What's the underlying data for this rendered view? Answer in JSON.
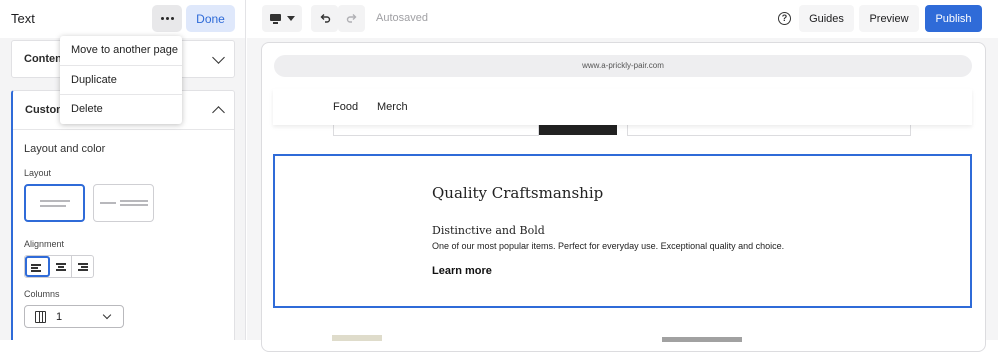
{
  "panel": {
    "title": "Text",
    "done_label": "Done",
    "content_label": "Content",
    "customize_label": "Customize",
    "layout_color_heading": "Layout and color",
    "layout_label": "Layout",
    "alignment_label": "Alignment",
    "columns_label": "Columns",
    "columns_value": "1",
    "selected_layout": "left-aligned",
    "selected_alignment": "left"
  },
  "menu": {
    "items": [
      "Move to another page",
      "Duplicate",
      "Delete"
    ]
  },
  "toolbar": {
    "device": "desktop",
    "autosaved": "Autosaved",
    "guides": "Guides",
    "preview": "Preview",
    "publish": "Publish"
  },
  "site": {
    "url": "www.a-prickly-pair.com",
    "nav": [
      "Food",
      "Merch"
    ],
    "section_title": "Quality Craftsmanship",
    "section_subtitle": "Distinctive and Bold",
    "section_body": "One of our most popular items. Perfect for everyday use. Exceptional quality and choice.",
    "section_link": "Learn more"
  },
  "colors": {
    "accent": "#2f6bd8",
    "publish_bg": "#2f6bd8",
    "done_bg": "#dfe8fb"
  }
}
